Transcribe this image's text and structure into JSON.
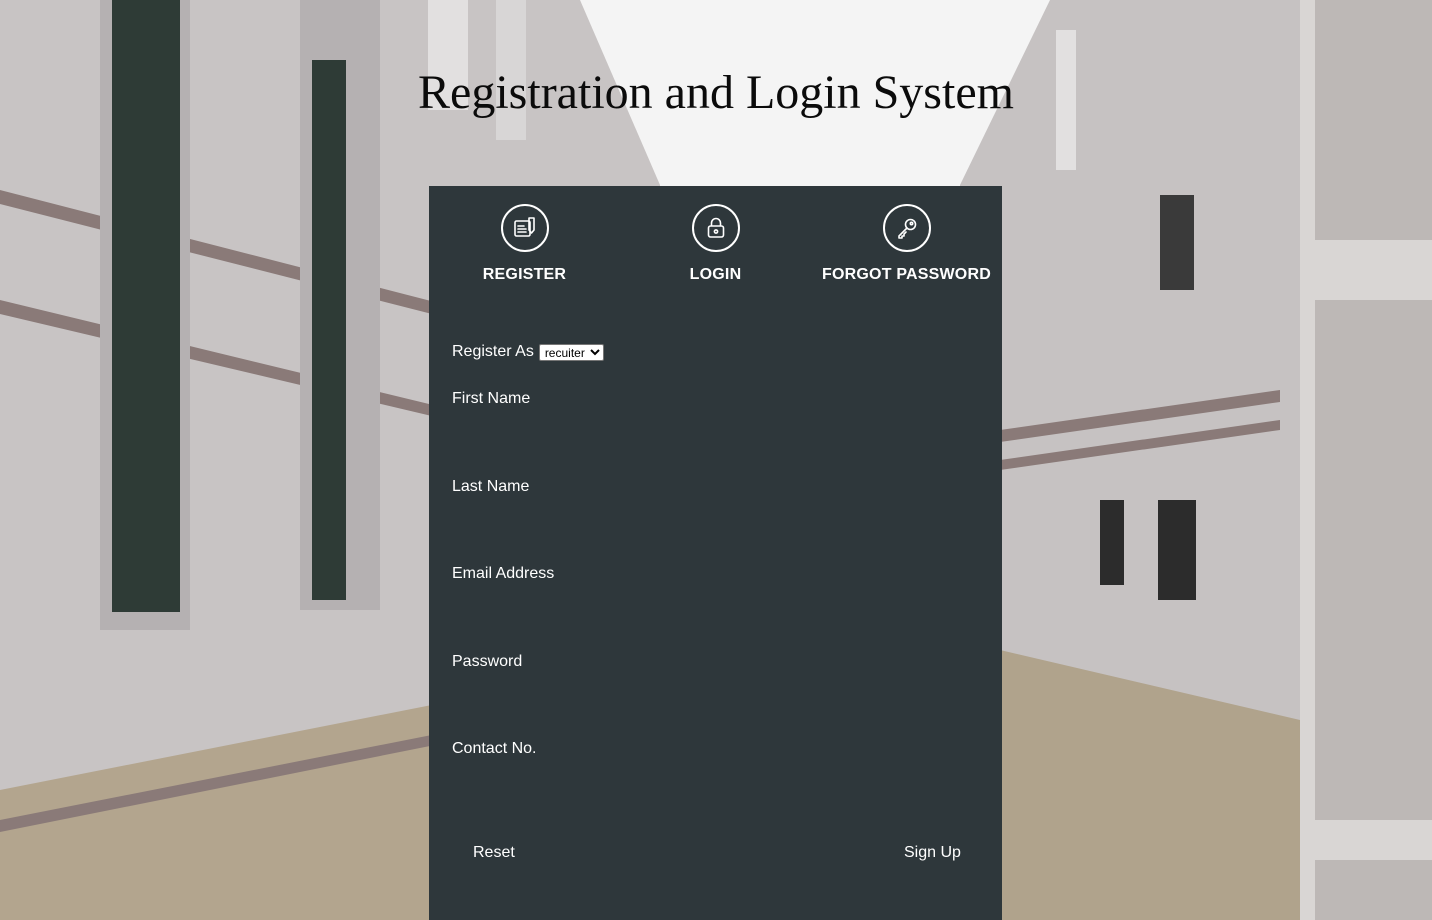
{
  "header": {
    "title": "Registration and Login System"
  },
  "tabs": [
    {
      "label": "REGISTER",
      "icon": "register-form-icon"
    },
    {
      "label": "LOGIN",
      "icon": "lock-icon"
    },
    {
      "label": "FORGOT PASSWORD",
      "icon": "key-icon"
    }
  ],
  "form": {
    "register_as_label": "Register As",
    "register_as_value": "recuiter",
    "fields": {
      "first_name": {
        "label": "First Name",
        "value": ""
      },
      "last_name": {
        "label": "Last Name",
        "value": ""
      },
      "email": {
        "label": "Email Address",
        "value": ""
      },
      "password": {
        "label": "Password",
        "value": ""
      },
      "contact": {
        "label": "Contact No.",
        "value": ""
      }
    },
    "reset_label": "Reset",
    "signup_label": "Sign Up"
  },
  "colors": {
    "panel_background": "#2e373b",
    "text": "#ffffff",
    "title": "#0b0b0b"
  }
}
